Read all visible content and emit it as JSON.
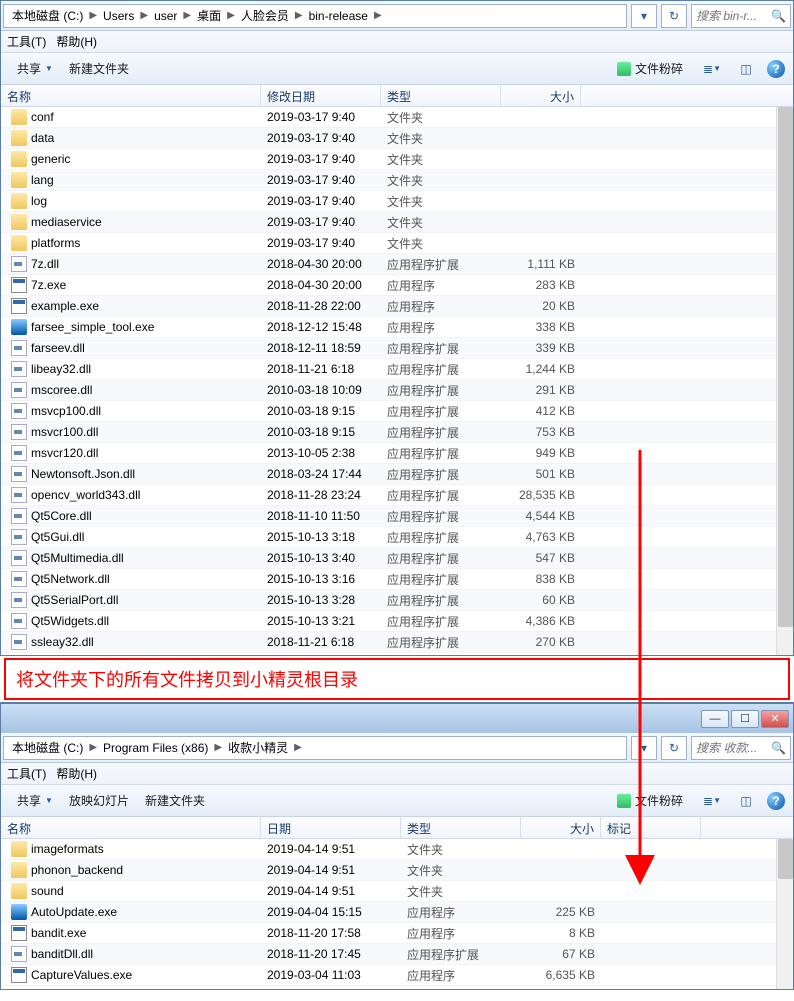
{
  "window1": {
    "breadcrumb": [
      "本地磁盘 (C:)",
      "Users",
      "user",
      "桌面",
      "人脸会员",
      "bin-release"
    ],
    "search_placeholder": "搜索 bin-r...",
    "menu": {
      "tools": "工具(T)",
      "help": "帮助(H)"
    },
    "toolbar": {
      "organize": "共享",
      "newfolder": "新建文件夹",
      "shred": "文件粉碎"
    },
    "columns": {
      "name": "名称",
      "date": "修改日期",
      "type": "类型",
      "size": "大小"
    },
    "files": [
      {
        "icon": "folder",
        "name": "conf",
        "date": "2019-03-17 9:40",
        "type": "文件夹",
        "size": ""
      },
      {
        "icon": "folder",
        "name": "data",
        "date": "2019-03-17 9:40",
        "type": "文件夹",
        "size": ""
      },
      {
        "icon": "folder",
        "name": "generic",
        "date": "2019-03-17 9:40",
        "type": "文件夹",
        "size": ""
      },
      {
        "icon": "folder",
        "name": "lang",
        "date": "2019-03-17 9:40",
        "type": "文件夹",
        "size": ""
      },
      {
        "icon": "folder",
        "name": "log",
        "date": "2019-03-17 9:40",
        "type": "文件夹",
        "size": ""
      },
      {
        "icon": "folder",
        "name": "mediaservice",
        "date": "2019-03-17 9:40",
        "type": "文件夹",
        "size": ""
      },
      {
        "icon": "folder",
        "name": "platforms",
        "date": "2019-03-17 9:40",
        "type": "文件夹",
        "size": ""
      },
      {
        "icon": "dll",
        "name": "7z.dll",
        "date": "2018-04-30 20:00",
        "type": "应用程序扩展",
        "size": "1,111 KB"
      },
      {
        "icon": "exe",
        "name": "7z.exe",
        "date": "2018-04-30 20:00",
        "type": "应用程序",
        "size": "283 KB"
      },
      {
        "icon": "exe",
        "name": "example.exe",
        "date": "2018-11-28 22:00",
        "type": "应用程序",
        "size": "20 KB"
      },
      {
        "icon": "app",
        "name": "farsee_simple_tool.exe",
        "date": "2018-12-12 15:48",
        "type": "应用程序",
        "size": "338 KB"
      },
      {
        "icon": "dll",
        "name": "farseev.dll",
        "date": "2018-12-11 18:59",
        "type": "应用程序扩展",
        "size": "339 KB"
      },
      {
        "icon": "dll",
        "name": "libeay32.dll",
        "date": "2018-11-21 6:18",
        "type": "应用程序扩展",
        "size": "1,244 KB"
      },
      {
        "icon": "dll",
        "name": "mscoree.dll",
        "date": "2010-03-18 10:09",
        "type": "应用程序扩展",
        "size": "291 KB"
      },
      {
        "icon": "dll",
        "name": "msvcp100.dll",
        "date": "2010-03-18 9:15",
        "type": "应用程序扩展",
        "size": "412 KB"
      },
      {
        "icon": "dll",
        "name": "msvcr100.dll",
        "date": "2010-03-18 9:15",
        "type": "应用程序扩展",
        "size": "753 KB"
      },
      {
        "icon": "dll",
        "name": "msvcr120.dll",
        "date": "2013-10-05 2:38",
        "type": "应用程序扩展",
        "size": "949 KB"
      },
      {
        "icon": "dll",
        "name": "Newtonsoft.Json.dll",
        "date": "2018-03-24 17:44",
        "type": "应用程序扩展",
        "size": "501 KB"
      },
      {
        "icon": "dll",
        "name": "opencv_world343.dll",
        "date": "2018-11-28 23:24",
        "type": "应用程序扩展",
        "size": "28,535 KB"
      },
      {
        "icon": "dll",
        "name": "Qt5Core.dll",
        "date": "2018-11-10 11:50",
        "type": "应用程序扩展",
        "size": "4,544 KB"
      },
      {
        "icon": "dll",
        "name": "Qt5Gui.dll",
        "date": "2015-10-13 3:18",
        "type": "应用程序扩展",
        "size": "4,763 KB"
      },
      {
        "icon": "dll",
        "name": "Qt5Multimedia.dll",
        "date": "2015-10-13 3:40",
        "type": "应用程序扩展",
        "size": "547 KB"
      },
      {
        "icon": "dll",
        "name": "Qt5Network.dll",
        "date": "2015-10-13 3:16",
        "type": "应用程序扩展",
        "size": "838 KB"
      },
      {
        "icon": "dll",
        "name": "Qt5SerialPort.dll",
        "date": "2015-10-13 3:28",
        "type": "应用程序扩展",
        "size": "60 KB"
      },
      {
        "icon": "dll",
        "name": "Qt5Widgets.dll",
        "date": "2015-10-13 3:21",
        "type": "应用程序扩展",
        "size": "4,386 KB"
      },
      {
        "icon": "dll",
        "name": "ssleay32.dll",
        "date": "2018-11-21 6:18",
        "type": "应用程序扩展",
        "size": "270 KB"
      }
    ]
  },
  "annotation": "将文件夹下的所有文件拷贝到小精灵根目录",
  "window2": {
    "breadcrumb": [
      "本地磁盘 (C:)",
      "Program Files (x86)",
      "收款小精灵"
    ],
    "search_placeholder": "搜索 收款...",
    "menu": {
      "tools": "工具(T)",
      "help": "帮助(H)"
    },
    "toolbar": {
      "organize": "共享",
      "slideshow": "放映幻灯片",
      "newfolder": "新建文件夹",
      "shred": "文件粉碎"
    },
    "columns": {
      "name": "名称",
      "date": "日期",
      "type": "类型",
      "size": "大小",
      "tag": "标记"
    },
    "files": [
      {
        "icon": "folder",
        "name": "imageformats",
        "date": "2019-04-14 9:51",
        "type": "文件夹",
        "size": ""
      },
      {
        "icon": "folder",
        "name": "phonon_backend",
        "date": "2019-04-14 9:51",
        "type": "文件夹",
        "size": ""
      },
      {
        "icon": "folder",
        "name": "sound",
        "date": "2019-04-14 9:51",
        "type": "文件夹",
        "size": ""
      },
      {
        "icon": "app",
        "name": "AutoUpdate.exe",
        "date": "2019-04-04 15:15",
        "type": "应用程序",
        "size": "225 KB"
      },
      {
        "icon": "exe",
        "name": "bandit.exe",
        "date": "2018-11-20 17:58",
        "type": "应用程序",
        "size": "8 KB"
      },
      {
        "icon": "dll",
        "name": "banditDll.dll",
        "date": "2018-11-20 17:45",
        "type": "应用程序扩展",
        "size": "67 KB"
      },
      {
        "icon": "exe",
        "name": "CaptureValues.exe",
        "date": "2019-03-04 11:03",
        "type": "应用程序",
        "size": "6,635 KB"
      }
    ]
  }
}
